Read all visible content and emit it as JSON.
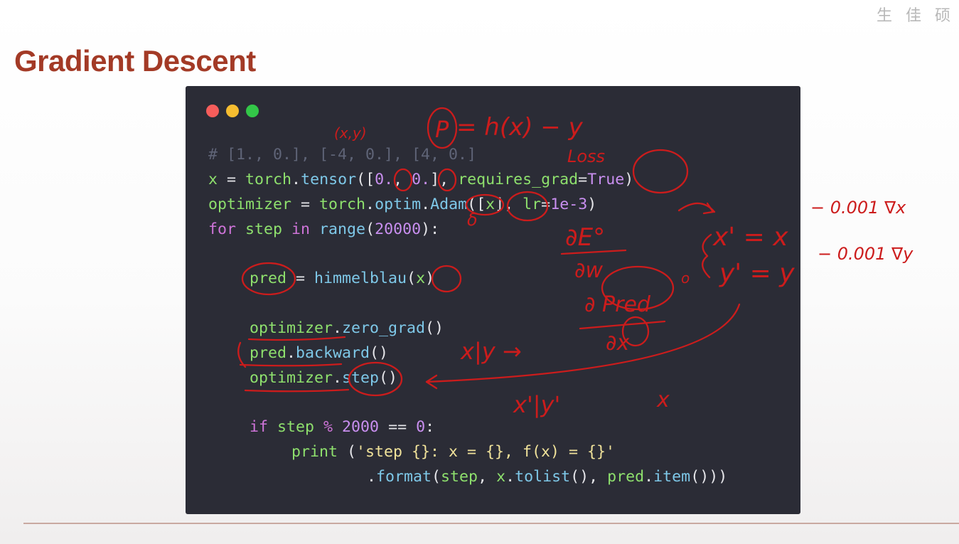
{
  "slide": {
    "title": "Gradient Descent",
    "watermark": "生 佳 硕"
  },
  "code": {
    "comment": "# [1., 0.], [-4, 0.], [4, 0.]",
    "line_x": {
      "var": "x",
      "eq": " = ",
      "obj": "torch",
      "dot": ".",
      "fn": "tensor",
      "args_open": "([",
      "n1": "0.",
      "comma": ", ",
      "n2": "0.",
      "args_close": "], ",
      "kw": "requires_grad",
      "assign": "=",
      "val": "True",
      "close": ")"
    },
    "line_opt": {
      "var": "optimizer",
      "eq": " = ",
      "obj": "torch",
      "dot1": ".",
      "mod": "optim",
      "dot2": ".",
      "fn": "Adam",
      "args_open": "([",
      "arg": "x",
      "args_mid": "], ",
      "kw": "lr",
      "assign": "=",
      "val": "1e-3",
      "close": ")"
    },
    "line_for": {
      "kw1": "for",
      "var": " step ",
      "kw2": "in",
      "fn": " range",
      "open": "(",
      "num": "20000",
      "close": "):"
    },
    "line_pred": {
      "var": "pred",
      "eq": " = ",
      "fn": "himmelblau",
      "open": "(",
      "arg": "x",
      "close": ")"
    },
    "line_zero": {
      "obj": "optimizer",
      "dot": ".",
      "fn": "zero_grad",
      "call": "()"
    },
    "line_back": {
      "obj": "pred",
      "dot": ".",
      "fn": "backward",
      "call": "()"
    },
    "line_step": {
      "obj": "optimizer",
      "dot": ".",
      "fn": "step",
      "call": "()"
    },
    "line_if": {
      "kw": "if",
      "var": " step ",
      "op": "%",
      "num1": " 2000",
      "eqeq": " == ",
      "num2": "0",
      "colon": ":"
    },
    "line_print": {
      "fn": "print",
      "open": " (",
      "str": "'step {}: x = {}, f(x) = {}'"
    },
    "line_format": {
      "dot": ".",
      "fn": "format",
      "open": "(",
      "a1": "step",
      "sep1": ", ",
      "a2": "x",
      "dot2": ".",
      "fn2": "tolist",
      "c1": "(), ",
      "a3": "pred",
      "dot3": ".",
      "fn3": "item",
      "close": "()))"
    }
  },
  "annotations": {
    "t_P_eq": "= h(x)  −  y",
    "t_P": "P",
    "t_xy": "(x,y)",
    "t_loss": "Loss",
    "t_delta": "δ",
    "t_dE": "∂E°",
    "t_dw": "∂w",
    "t_pred": "∂ Pred",
    "t_dot": "o",
    "t_dx": "∂x",
    "t_x1": "x' = x",
    "t_y1": "y' = y",
    "t_r1": "− 0.001 ∇x",
    "t_r2": "− 0.001 ∇y",
    "t_xy2": "x|y →",
    "t_xy3": "x'|y'",
    "t_x": "x"
  }
}
